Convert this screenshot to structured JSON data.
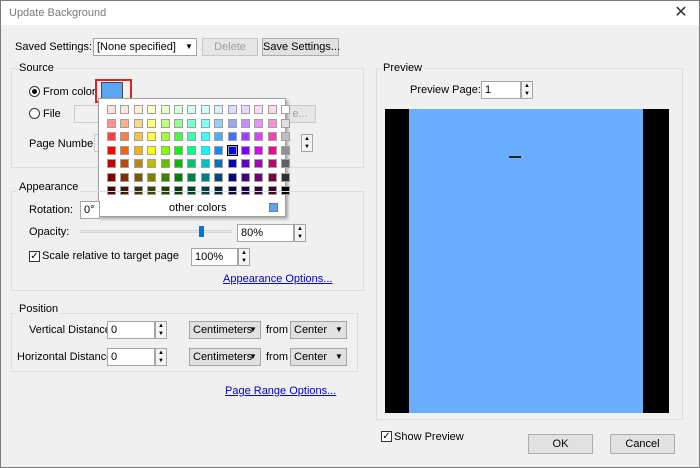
{
  "window": {
    "title": "Update Background",
    "close_glyph": "✕"
  },
  "saved_settings": {
    "label": "Saved Settings:",
    "value": "[None specified]",
    "delete_label": "Delete",
    "save_label": "Save Settings..."
  },
  "source": {
    "group_label": "Source",
    "from_color_label": "From color",
    "file_label": "File",
    "page_number_label": "Page Number:",
    "selected_color": "#5aa6f3",
    "browse_label": "e..."
  },
  "palette": {
    "other_colors_label": "other colors",
    "other_swatch": "#5aa6f3",
    "rows": [
      [
        "#ffe0e0",
        "#ffe8d8",
        "#fff2d0",
        "#ffffd0",
        "#e8ffd0",
        "#d8ffd8",
        "#d0fff0",
        "#d0ffff",
        "#d8f0ff",
        "#d8e0ff",
        "#e8d8ff",
        "#f8d8ff",
        "#ffd8f0",
        "#ffffff"
      ],
      [
        "#ff9090",
        "#ffb080",
        "#ffd880",
        "#ffff80",
        "#c0ff80",
        "#90ff90",
        "#80ffd0",
        "#80ffff",
        "#90d0ff",
        "#90a8ff",
        "#c090ff",
        "#f090ff",
        "#ff90d0",
        "#e0e0e0"
      ],
      [
        "#ff4040",
        "#ff8040",
        "#ffc040",
        "#ffff40",
        "#a0ff40",
        "#40ff40",
        "#40ffb0",
        "#40ffff",
        "#40b0ff",
        "#4070ff",
        "#a040ff",
        "#e040ff",
        "#ff40b0",
        "#c0c0c0"
      ],
      [
        "#ff0000",
        "#ff6000",
        "#ffb000",
        "#ffff00",
        "#80ff00",
        "#00ff00",
        "#00ff90",
        "#00ffff",
        "#0090ff",
        "#0000ff",
        "#8000ff",
        "#e000ff",
        "#ff0090",
        "#909090"
      ],
      [
        "#c00000",
        "#c04800",
        "#c08800",
        "#c0c000",
        "#60c000",
        "#00c000",
        "#00c070",
        "#00c0c0",
        "#0070c0",
        "#0000c0",
        "#6000c0",
        "#a800c0",
        "#c00070",
        "#606060"
      ],
      [
        "#800000",
        "#803000",
        "#805800",
        "#808000",
        "#408000",
        "#008000",
        "#008048",
        "#008080",
        "#004880",
        "#000080",
        "#400080",
        "#700080",
        "#800048",
        "#303030"
      ],
      [
        "#400000",
        "#401800",
        "#402c00",
        "#404000",
        "#204000",
        "#004000",
        "#004024",
        "#004040",
        "#002440",
        "#000040",
        "#200040",
        "#380040",
        "#400024",
        "#000000"
      ]
    ],
    "selected_index": [
      3,
      9
    ]
  },
  "appearance": {
    "group_label": "Appearance",
    "rotation_label": "Rotation:",
    "rotation_value": "0°",
    "opacity_label": "Opacity:",
    "opacity_value": "80%",
    "opacity_fraction": 0.8,
    "scale_label": "Scale relative to target page",
    "scale_value": "100%",
    "scale_checked": true,
    "options_link": "Appearance Options..."
  },
  "position": {
    "group_label": "Position",
    "vertical_label": "Vertical Distance:",
    "vertical_value": "0",
    "vertical_unit": "Centimeters",
    "vertical_from": "Center",
    "horizontal_label": "Horizontal Distance:",
    "horizontal_value": "0",
    "horizontal_unit": "Centimeters",
    "horizontal_from": "Center",
    "from_label": "from"
  },
  "page_range_link": "Page Range Options...",
  "preview": {
    "group_label": "Preview",
    "page_label": "Preview Page:",
    "page_value": "1",
    "show_preview_label": "Show Preview",
    "show_preview_checked": true,
    "background_color": "#69aeff"
  },
  "buttons": {
    "ok": "OK",
    "cancel": "Cancel"
  }
}
